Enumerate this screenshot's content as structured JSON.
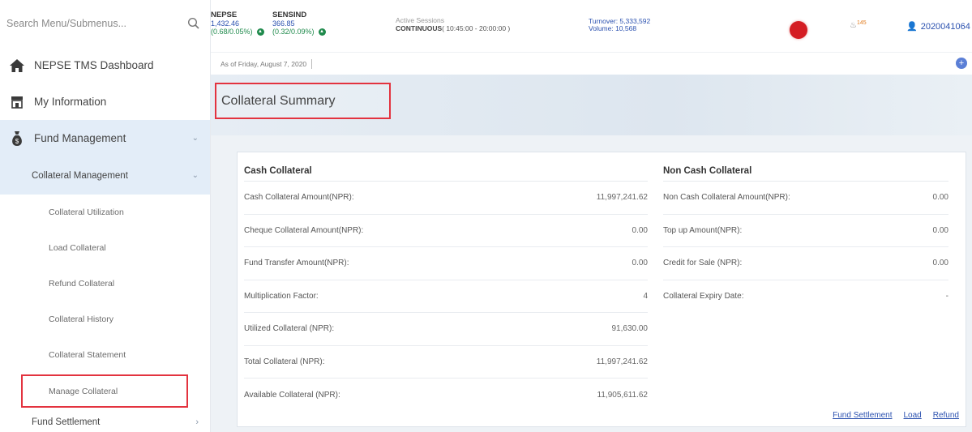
{
  "sidebar": {
    "search_placeholder": "Search Menu/Submenus...",
    "items": [
      {
        "label": "NEPSE TMS Dashboard"
      },
      {
        "label": "My Information"
      },
      {
        "label": "Fund Management"
      }
    ],
    "sub_item": "Collateral Management",
    "leaves": [
      "Collateral Utilization",
      "Load Collateral",
      "Refund Collateral",
      "Collateral History",
      "Collateral Statement",
      "Manage Collateral"
    ],
    "bottom_item": "Fund Settlement"
  },
  "header": {
    "nepse": {
      "name": "NEPSE",
      "value": "1,432.46",
      "change": "(0.68/0.05%)"
    },
    "sensind": {
      "name": "SENSIND",
      "value": "366.85",
      "change": "(0.32/0.09%)"
    },
    "session_label": "Active Sessions",
    "session_state": "CONTINUOUS",
    "session_time": "( 10:45:00 - 20:00:00 )",
    "turnover": "Turnover: 5,333,592",
    "volume": "Volume: 10,568",
    "notif_count": "145",
    "user": "2020041064",
    "date": "As of Friday, August 7, 2020"
  },
  "page": {
    "title": "Collateral Summary",
    "cash": {
      "heading": "Cash Collateral",
      "rows": [
        {
          "label": "Cash Collateral Amount(NPR):",
          "value": "11,997,241.62"
        },
        {
          "label": "Cheque Collateral Amount(NPR):",
          "value": "0.00"
        },
        {
          "label": "Fund Transfer Amount(NPR):",
          "value": "0.00"
        },
        {
          "label": "Multiplication Factor:",
          "value": "4"
        },
        {
          "label": "Utilized Collateral (NPR):",
          "value": "91,630.00"
        },
        {
          "label": "Total Collateral (NPR):",
          "value": "11,997,241.62"
        },
        {
          "label": "Available Collateral (NPR):",
          "value": "11,905,611.62"
        }
      ]
    },
    "noncash": {
      "heading": "Non Cash Collateral",
      "rows": [
        {
          "label": "Non Cash Collateral Amount(NPR):",
          "value": "0.00"
        },
        {
          "label": "Top up Amount(NPR):",
          "value": "0.00"
        },
        {
          "label": "Credit for Sale (NPR):",
          "value": "0.00"
        },
        {
          "label": "Collateral Expiry Date:",
          "value": "-"
        }
      ]
    },
    "links": [
      "Fund Settlement",
      "Load",
      "Refund"
    ]
  },
  "icons": {
    "search": "search-icon",
    "dashboard": "home-icon",
    "info": "store-icon",
    "fund": "money-bag-icon",
    "user": "user-icon",
    "bell": "bell-icon",
    "plus": "plus-icon"
  },
  "colors": {
    "accent": "#2c52b0",
    "highlight_border": "#e3333f",
    "live_dot": "#d41d23",
    "positive": "#1f8a4c"
  }
}
